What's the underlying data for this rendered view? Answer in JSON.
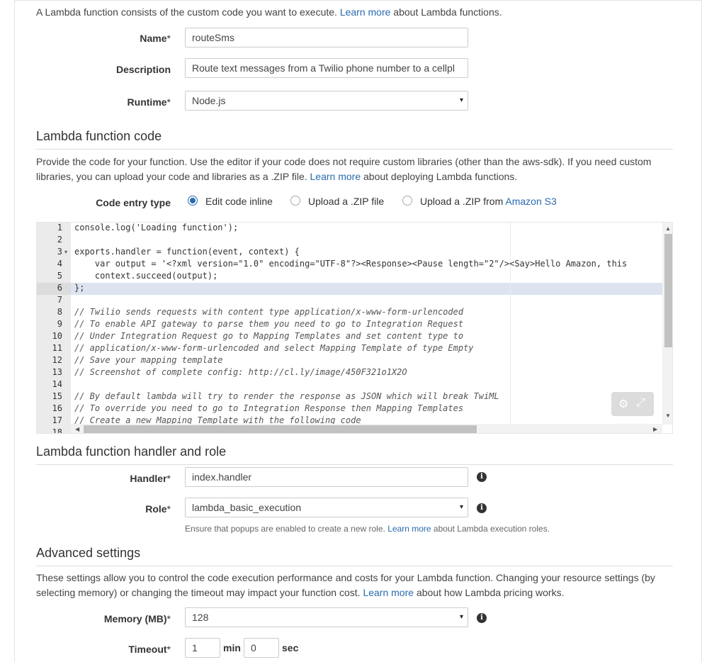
{
  "intro": {
    "text_before": "A Lambda function consists of the custom code you want to execute.",
    "link": "Learn more",
    "text_after": "about Lambda functions."
  },
  "basic": {
    "name_label": "Name",
    "name_value": "routeSms",
    "description_label": "Description",
    "description_value": "Route text messages from a Twilio phone number to a cellpl",
    "runtime_label": "Runtime",
    "runtime_value": "Node.js",
    "required_mark": "*"
  },
  "code_section": {
    "title": "Lambda function code",
    "para_before": "Provide the code for your function. Use the editor if your code does not require custom libraries (other than the aws-sdk). If you need custom libraries, you can upload your code and libraries as a .ZIP file.",
    "para_link": "Learn more",
    "para_after": "about deploying Lambda functions.",
    "entry_type_label": "Code entry type",
    "options": {
      "inline": "Edit code inline",
      "zip": "Upload a .ZIP file",
      "s3_prefix": "Upload a .ZIP from",
      "s3_link": "Amazon S3"
    },
    "selected_option": "Edit code inline"
  },
  "editor": {
    "line_numbers": [
      "1",
      "2",
      "3",
      "4",
      "5",
      "6",
      "7",
      "8",
      "9",
      "10",
      "11",
      "12",
      "13",
      "14",
      "15",
      "16",
      "17",
      "18"
    ],
    "active_line": 6,
    "lines": [
      "console.log('Loading function');",
      "",
      "exports.handler = function(event, context) {",
      "    var output = '<?xml version=\"1.0\" encoding=\"UTF-8\"?><Response><Pause length=\"2\"/><Say>Hello Amazon, this",
      "    context.succeed(output);",
      "};",
      "",
      "// Twilio sends requests with content type application/x-www-form-urlencoded",
      "// To enable API gateway to parse them you need to go to Integration Request",
      "// Under Integration Request go to Mapping Templates and set content type to",
      "// application/x-www-form-urlencoded and select Mapping Template of type Empty",
      "// Save your mapping template",
      "// Screenshot of complete config: http://cl.ly/image/450F321o1X2O",
      "",
      "// By default lambda will try to render the response as JSON which will break TwiML",
      "// To override you need to go to Integration Response then Mapping Templates",
      "// Create a new Mapping Template with the following code",
      ""
    ]
  },
  "handler_section": {
    "title": "Lambda function handler and role",
    "handler_label": "Handler",
    "handler_value": "index.handler",
    "role_label": "Role",
    "role_value": "lambda_basic_execution",
    "help_before": "Ensure that popups are enabled to create a new role.",
    "help_link": "Learn more",
    "help_after": "about Lambda execution roles."
  },
  "advanced": {
    "title": "Advanced settings",
    "para_before": "These settings allow you to control the code execution performance and costs for your Lambda function. Changing your resource settings (by selecting memory) or changing the timeout may impact your function cost.",
    "para_link": "Learn more",
    "para_after": "about how Lambda pricing works.",
    "memory_label": "Memory (MB)",
    "memory_value": "128",
    "timeout_label": "Timeout",
    "timeout_min": "1",
    "min_unit": "min",
    "timeout_sec": "0",
    "sec_unit": "sec"
  },
  "icons": {
    "select_arrow": "▾",
    "info": "i",
    "gear": "⚙",
    "expand": "⤢"
  },
  "colors": {
    "link": "#2a6bb0",
    "active_line": "#dde4f0"
  }
}
